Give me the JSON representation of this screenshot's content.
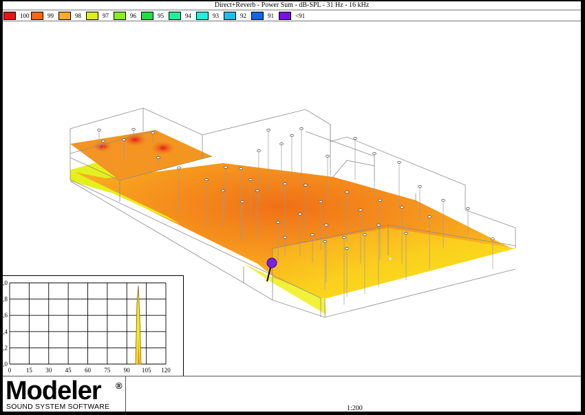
{
  "window": {
    "title": "Direct+Reverb - Power Sum - dB-SPL - 31 Hz - 16 kHz"
  },
  "legend": [
    {
      "label": "100",
      "color": "#ee1111"
    },
    {
      "label": "99",
      "color": "#ff6611"
    },
    {
      "label": "98",
      "color": "#ffaa22"
    },
    {
      "label": "97",
      "color": "#ddee22"
    },
    {
      "label": "96",
      "color": "#88ee22"
    },
    {
      "label": "95",
      "color": "#22dd44"
    },
    {
      "label": "94",
      "color": "#22ee99"
    },
    {
      "label": "93",
      "color": "#22eedd"
    },
    {
      "label": "92",
      "color": "#22bbee"
    },
    {
      "label": "91",
      "color": "#1166ee"
    },
    {
      "label": "<91",
      "color": "#7711dd"
    }
  ],
  "histogram": {
    "x_ticks": [
      "0",
      "15",
      "30",
      "45",
      "60",
      "75",
      "90",
      "105",
      "120"
    ],
    "y_ticks": [
      ",0",
      ",8",
      ",6",
      ",4",
      ",2",
      ",0"
    ]
  },
  "logo": {
    "name": "Modeler",
    "mark": "®",
    "subtitle": "SOUND SYSTEM SOFTWARE"
  },
  "status": {
    "scale": "1:200"
  }
}
